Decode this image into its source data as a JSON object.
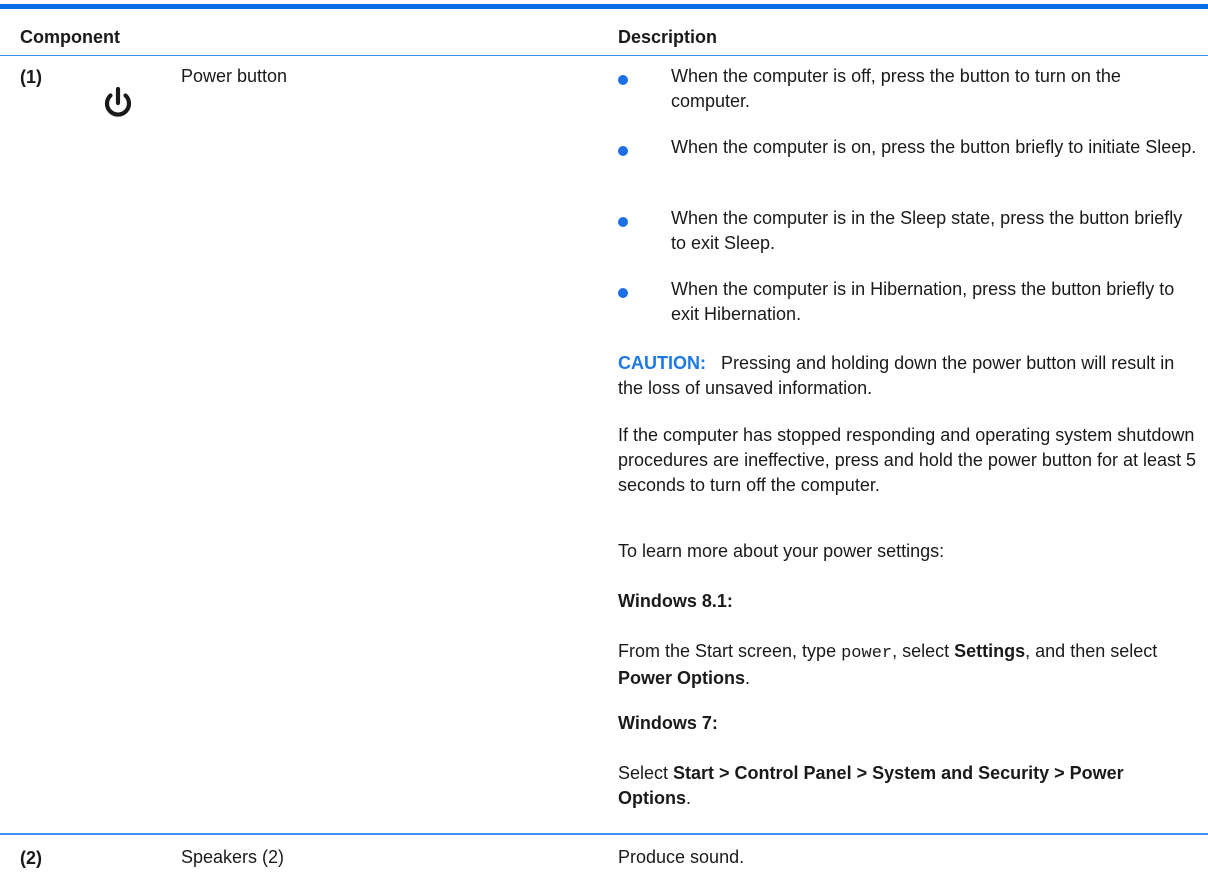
{
  "header": {
    "component": "Component",
    "description": "Description"
  },
  "rows": [
    {
      "number": "(1)",
      "icon": "power-icon",
      "name": "Power button",
      "bullets": [
        "When the computer is off, press the button to turn on the computer.",
        "When the computer is on, press the button briefly to initiate Sleep.",
        "When the computer is in the Sleep state, press the button briefly to exit Sleep.",
        "When the computer is in Hibernation, press the button briefly to exit Hibernation."
      ],
      "caution_label": "CAUTION:",
      "caution_text": "Pressing and holding down the power button will result in the loss of unsaved information.",
      "unresponsive_text": "If the computer has stopped responding and operating system shutdown procedures are ineffective, press and hold the power button for at least 5 seconds to turn off the computer.",
      "learn_more": "To learn more about your power settings:",
      "win81_heading": "Windows 8.1:",
      "win81_pre": "From the Start screen, type ",
      "win81_code": "power",
      "win81_mid": ", select ",
      "win81_settings": "Settings",
      "win81_mid2": ", and then select ",
      "win81_power_options": "Power Options",
      "win81_end": ".",
      "win7_heading": "Windows 7:",
      "win7_pre": "Select ",
      "win7_path": "Start > Control Panel > System and Security > Power Options",
      "win7_end": "."
    },
    {
      "number": "(2)",
      "name": "Speakers (2)",
      "description": "Produce sound."
    }
  ],
  "colors": {
    "accent_blue": "#0a6ee6",
    "bullet_blue": "#1e6fe6",
    "caution_blue": "#1e79e6"
  }
}
